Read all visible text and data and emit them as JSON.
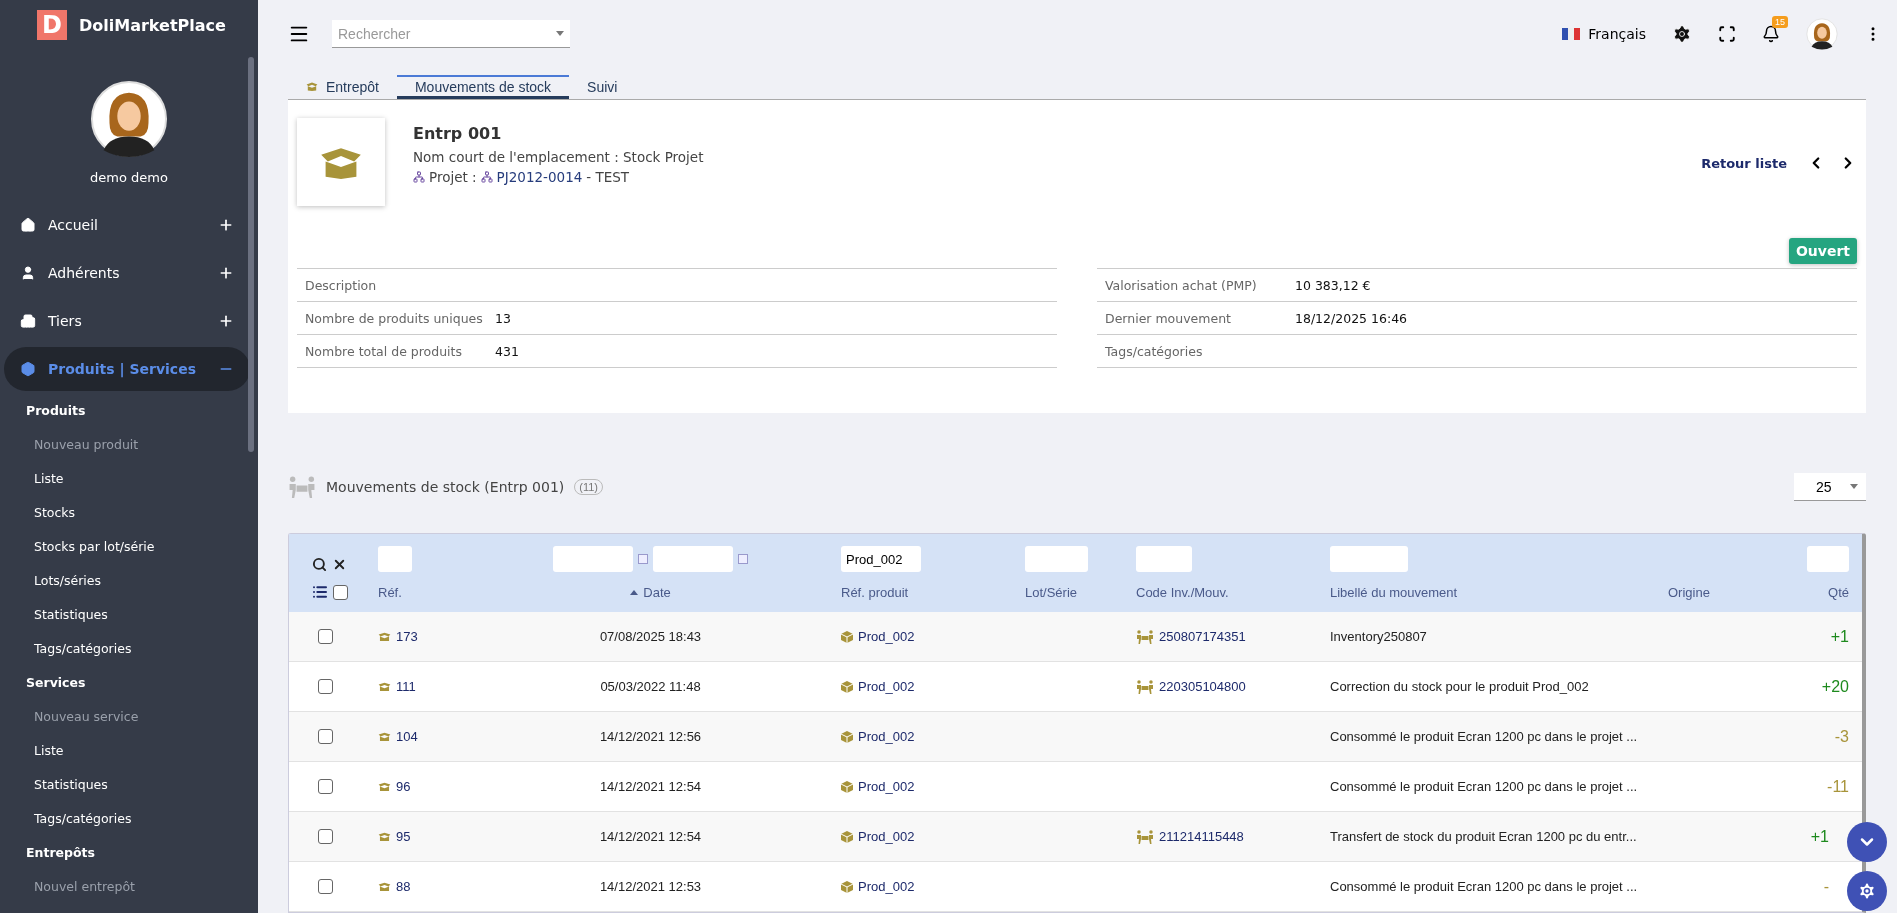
{
  "app": {
    "logo_letter": "D",
    "name": "DoliMarketPlace"
  },
  "sidebar": {
    "user": "demo demo",
    "menu": [
      {
        "label": "Accueil",
        "expanded": false,
        "selected": false
      },
      {
        "label": "Adhérents",
        "expanded": false,
        "selected": false
      },
      {
        "label": "Tiers",
        "expanded": false,
        "selected": false
      },
      {
        "label": "Produits | Services",
        "expanded": true,
        "selected": true
      }
    ],
    "submenu": [
      {
        "label": "Produits",
        "kind": "section"
      },
      {
        "label": "Nouveau produit",
        "kind": "new"
      },
      {
        "label": "Liste",
        "kind": "link"
      },
      {
        "label": "Stocks",
        "kind": "link"
      },
      {
        "label": "Stocks par lot/série",
        "kind": "link"
      },
      {
        "label": "Lots/séries",
        "kind": "link"
      },
      {
        "label": "Statistiques",
        "kind": "link"
      },
      {
        "label": "Tags/catégories",
        "kind": "link"
      },
      {
        "label": "Services",
        "kind": "section"
      },
      {
        "label": "Nouveau service",
        "kind": "new"
      },
      {
        "label": "Liste",
        "kind": "link"
      },
      {
        "label": "Statistiques",
        "kind": "link"
      },
      {
        "label": "Tags/catégories",
        "kind": "link"
      },
      {
        "label": "Entrepôts",
        "kind": "section"
      },
      {
        "label": "Nouvel entrepôt",
        "kind": "new"
      }
    ]
  },
  "topbar": {
    "search": {
      "placeholder": "Rechercher"
    },
    "language": "Français",
    "notifications": "15"
  },
  "tabs": [
    {
      "label": "Entrepôt",
      "selected": false
    },
    {
      "label": "Mouvements de stock",
      "selected": true
    },
    {
      "label": "Suivi",
      "selected": false
    }
  ],
  "warehouse": {
    "title": "Entrp 001",
    "short_name": "Nom court de l'emplacement : Stock Projet",
    "project_label": "Projet :",
    "project_ref": "PJ2012-0014",
    "project_name": "- TEST",
    "back_link": "Retour liste",
    "status": "Ouvert",
    "fields_left": [
      {
        "label": "Description"
      },
      {
        "label": "Nombre de produits uniques",
        "value": "13"
      },
      {
        "label": "Nombre total de produits",
        "value": "431"
      }
    ],
    "fields_right": [
      {
        "label": "Valorisation achat (PMP)",
        "value": "10 383,12 €"
      },
      {
        "label": "Dernier mouvement",
        "value": "18/12/2025 16:46"
      },
      {
        "label": "Tags/catégories"
      }
    ]
  },
  "movements": {
    "title": "Mouvements de stock (Entrp 001)",
    "count": "(11)",
    "page_size": "25",
    "select_all": {
      "checked": false
    },
    "columns": [
      {
        "label": "Réf.",
        "kind": "text",
        "sorted": false
      },
      {
        "label": "Date",
        "kind": "date",
        "sorted": true
      },
      {
        "label": "Réf. produit",
        "kind": "text",
        "filter_value": "Prod_002",
        "sorted": false
      },
      {
        "label": "Lot/Série",
        "kind": "text",
        "sorted": false
      },
      {
        "label": "Code Inv./Mouv.",
        "kind": "text",
        "sorted": false
      },
      {
        "label": "Libellé du mouvement",
        "kind": "text",
        "sorted": false
      },
      {
        "label": "Origine",
        "kind": "none",
        "sorted": false
      },
      {
        "label": "Qté",
        "kind": "text",
        "sorted": false
      }
    ],
    "rows": [
      {
        "checked": false,
        "ref": "173",
        "date": "07/08/2025 18:43",
        "product": "Prod_002",
        "code": "250807174351",
        "label": "Inventory250807",
        "qty": "+1",
        "kind": "in"
      },
      {
        "checked": false,
        "ref": "111",
        "date": "05/03/2022 11:48",
        "product": "Prod_002",
        "code": "220305104800",
        "label": "Correction du stock pour le produit Prod_002",
        "qty": "+20",
        "kind": "in"
      },
      {
        "checked": false,
        "ref": "104",
        "date": "14/12/2021 12:56",
        "product": "Prod_002",
        "label": "Consommé le produit Ecran 1200 pc dans le projet ...",
        "qty": "-3",
        "kind": "out"
      },
      {
        "checked": false,
        "ref": "96",
        "date": "14/12/2021 12:54",
        "product": "Prod_002",
        "label": "Consommé le produit Ecran 1200 pc dans le projet ...",
        "qty": "-11",
        "kind": "out"
      },
      {
        "checked": false,
        "ref": "95",
        "date": "14/12/2021 12:54",
        "product": "Prod_002",
        "code": "211214115448",
        "label": "Transfert de stock du produit Ecran 1200 pc du entr...",
        "qty": "+1",
        "kind": "in"
      },
      {
        "checked": false,
        "ref": "88",
        "date": "14/12/2021 12:53",
        "product": "Prod_002",
        "label": "Consommé le produit Ecran 1200 pc dans le projet ...",
        "qty": "-",
        "kind": "out"
      }
    ]
  }
}
